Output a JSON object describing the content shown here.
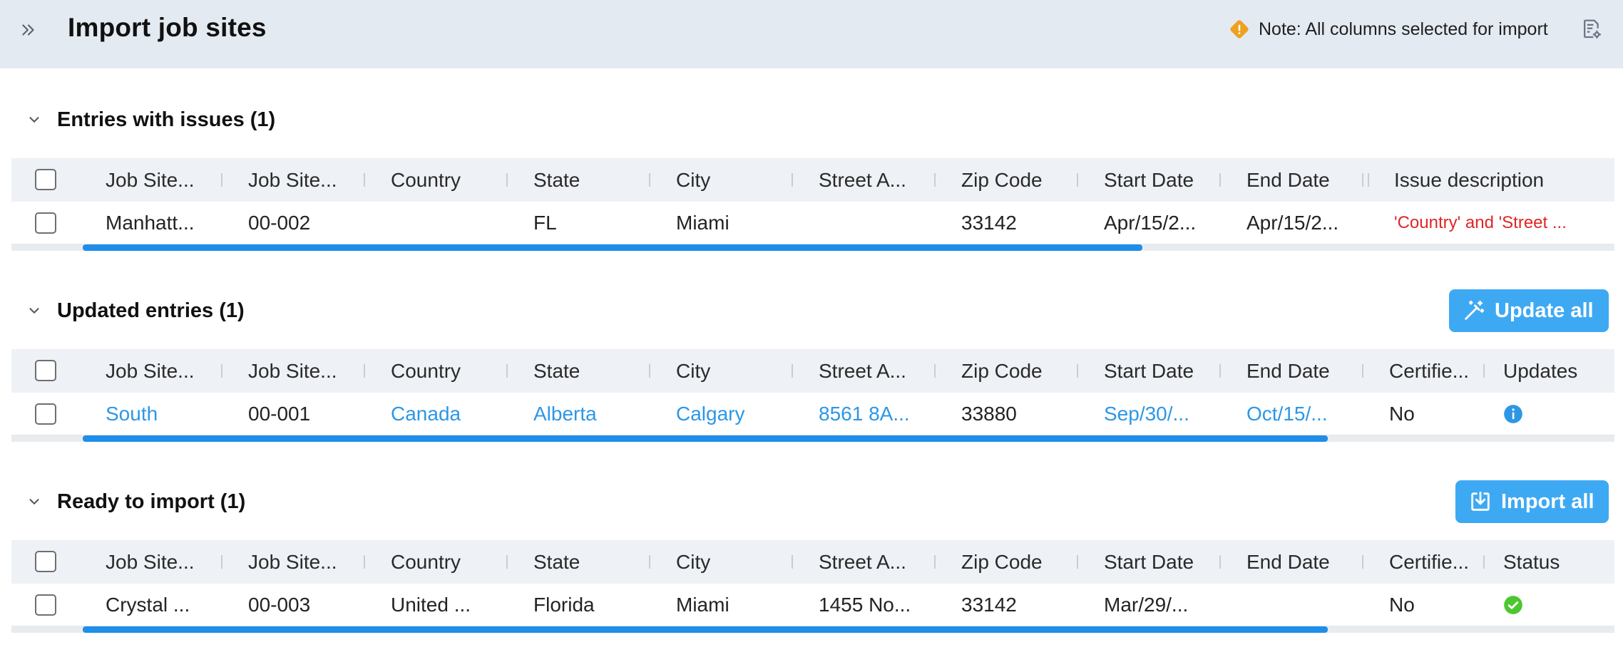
{
  "header": {
    "title": "Import job sites",
    "note": "Note: All columns selected for import",
    "colors": {
      "background": "#e4eaf2",
      "warning": "#f0a020"
    }
  },
  "sections": {
    "issues": {
      "title": "Entries with issues (1)",
      "columns": [
        "Job Site...",
        "Job Site...",
        "Country",
        "State",
        "City",
        "Street A...",
        "Zip Code",
        "Start Date",
        "End Date",
        "Issue description"
      ],
      "row": [
        "Manhatt...",
        "00-002",
        "",
        "FL",
        "Miami",
        "",
        "33142",
        "Apr/15/2...",
        "Apr/15/2...",
        "'Country' and 'Street ..."
      ]
    },
    "updated": {
      "title": "Updated entries (1)",
      "button_label": "Update all",
      "columns": [
        "Job Site...",
        "Job Site...",
        "Country",
        "State",
        "City",
        "Street A...",
        "Zip Code",
        "Start Date",
        "End Date",
        "Certifie...",
        "Updates"
      ],
      "row": [
        "South",
        "00-001",
        "Canada",
        "Alberta",
        "Calgary",
        "8561 8A...",
        "33880",
        "Sep/30/...",
        "Oct/15/...",
        "No"
      ],
      "updates_icon": "info-icon"
    },
    "ready": {
      "title": "Ready to import (1)",
      "button_label": "Import all",
      "columns": [
        "Job Site...",
        "Job Site...",
        "Country",
        "State",
        "City",
        "Street A...",
        "Zip Code",
        "Start Date",
        "End Date",
        "Certifie...",
        "Status"
      ],
      "row": [
        "Crystal ...",
        "00-003",
        "United ...",
        "Florida",
        "Miami",
        "1455 No...",
        "33142",
        "Mar/29/...",
        "",
        "No"
      ],
      "status_icon": "check-circle-icon"
    }
  },
  "colors": {
    "accent": "#3ea9f3",
    "link": "#2d97e6",
    "error": "#e02525",
    "success": "#4cc72f",
    "scrollbar": "#1e8ee8"
  }
}
